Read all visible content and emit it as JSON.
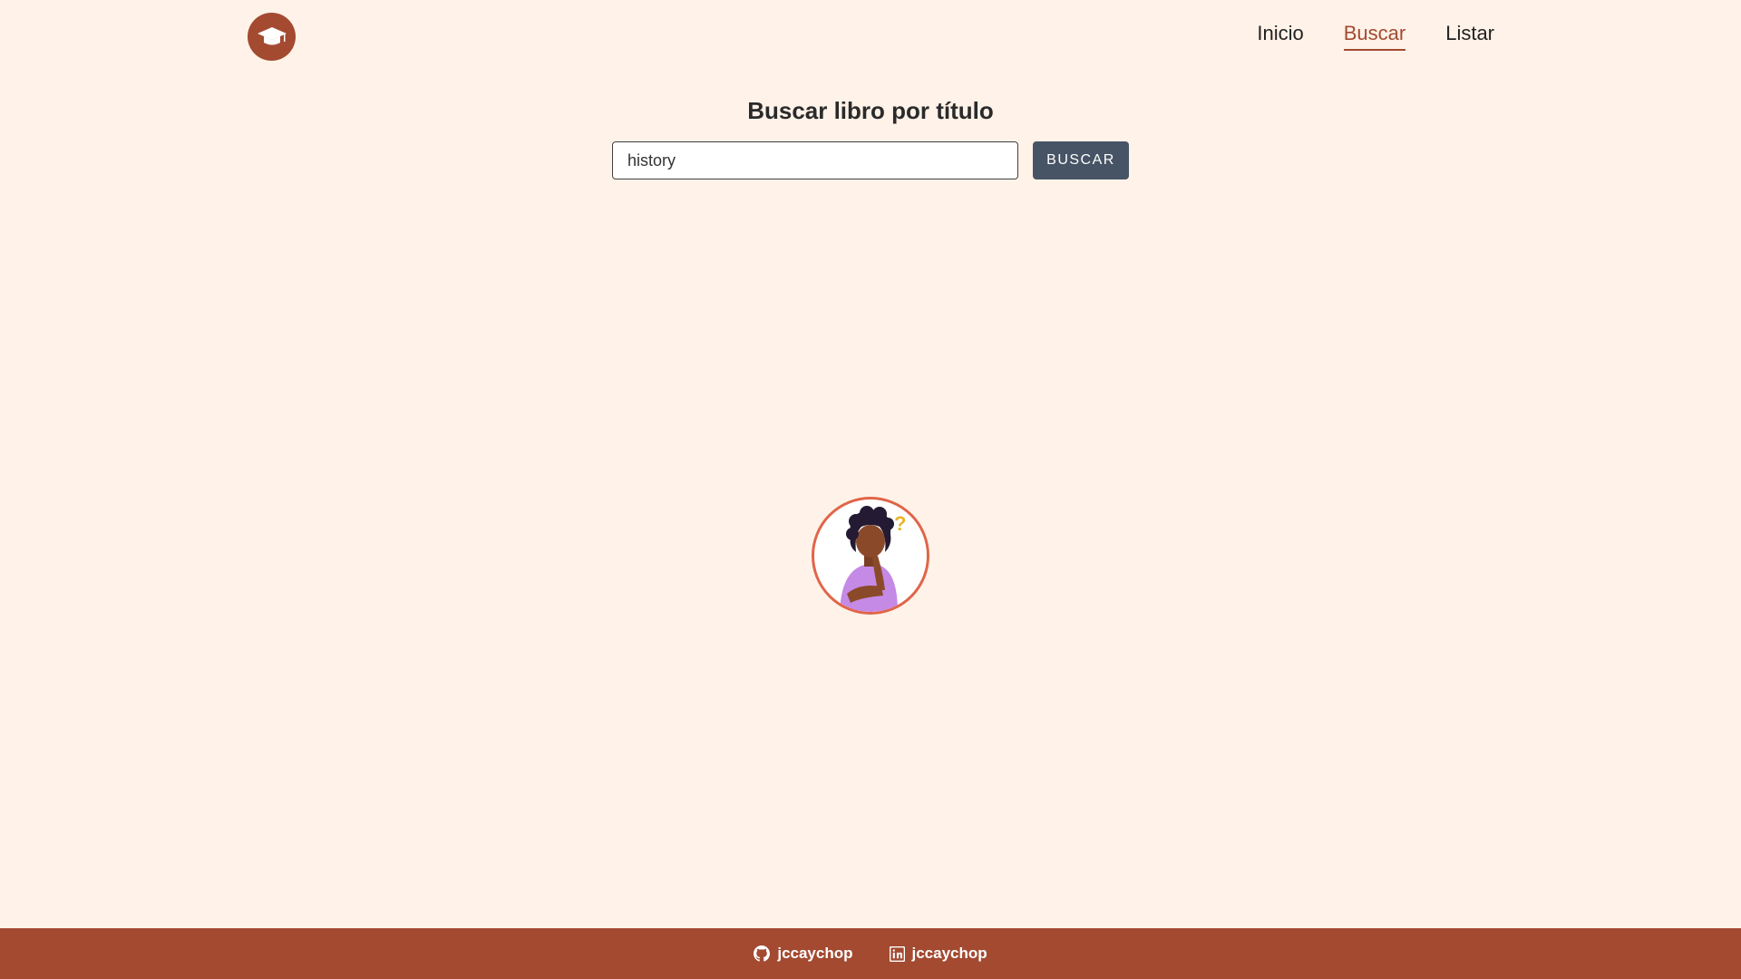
{
  "header": {
    "logo_icon": "graduation-cap-icon",
    "nav": [
      {
        "label": "Inicio",
        "active": false
      },
      {
        "label": "Buscar",
        "active": true
      },
      {
        "label": "Listar",
        "active": false
      }
    ]
  },
  "search": {
    "title": "Buscar libro por título",
    "input_value": "history",
    "button_label": "BUSCAR"
  },
  "illustration": {
    "icon": "thinking-person-illustration"
  },
  "footer": {
    "links": [
      {
        "icon": "github-icon",
        "label": "jccaychop"
      },
      {
        "icon": "linkedin-icon",
        "label": "jccaychop"
      }
    ]
  },
  "colors": {
    "background": "#fff2e8",
    "brand": "#a34a31",
    "button": "#475465"
  }
}
